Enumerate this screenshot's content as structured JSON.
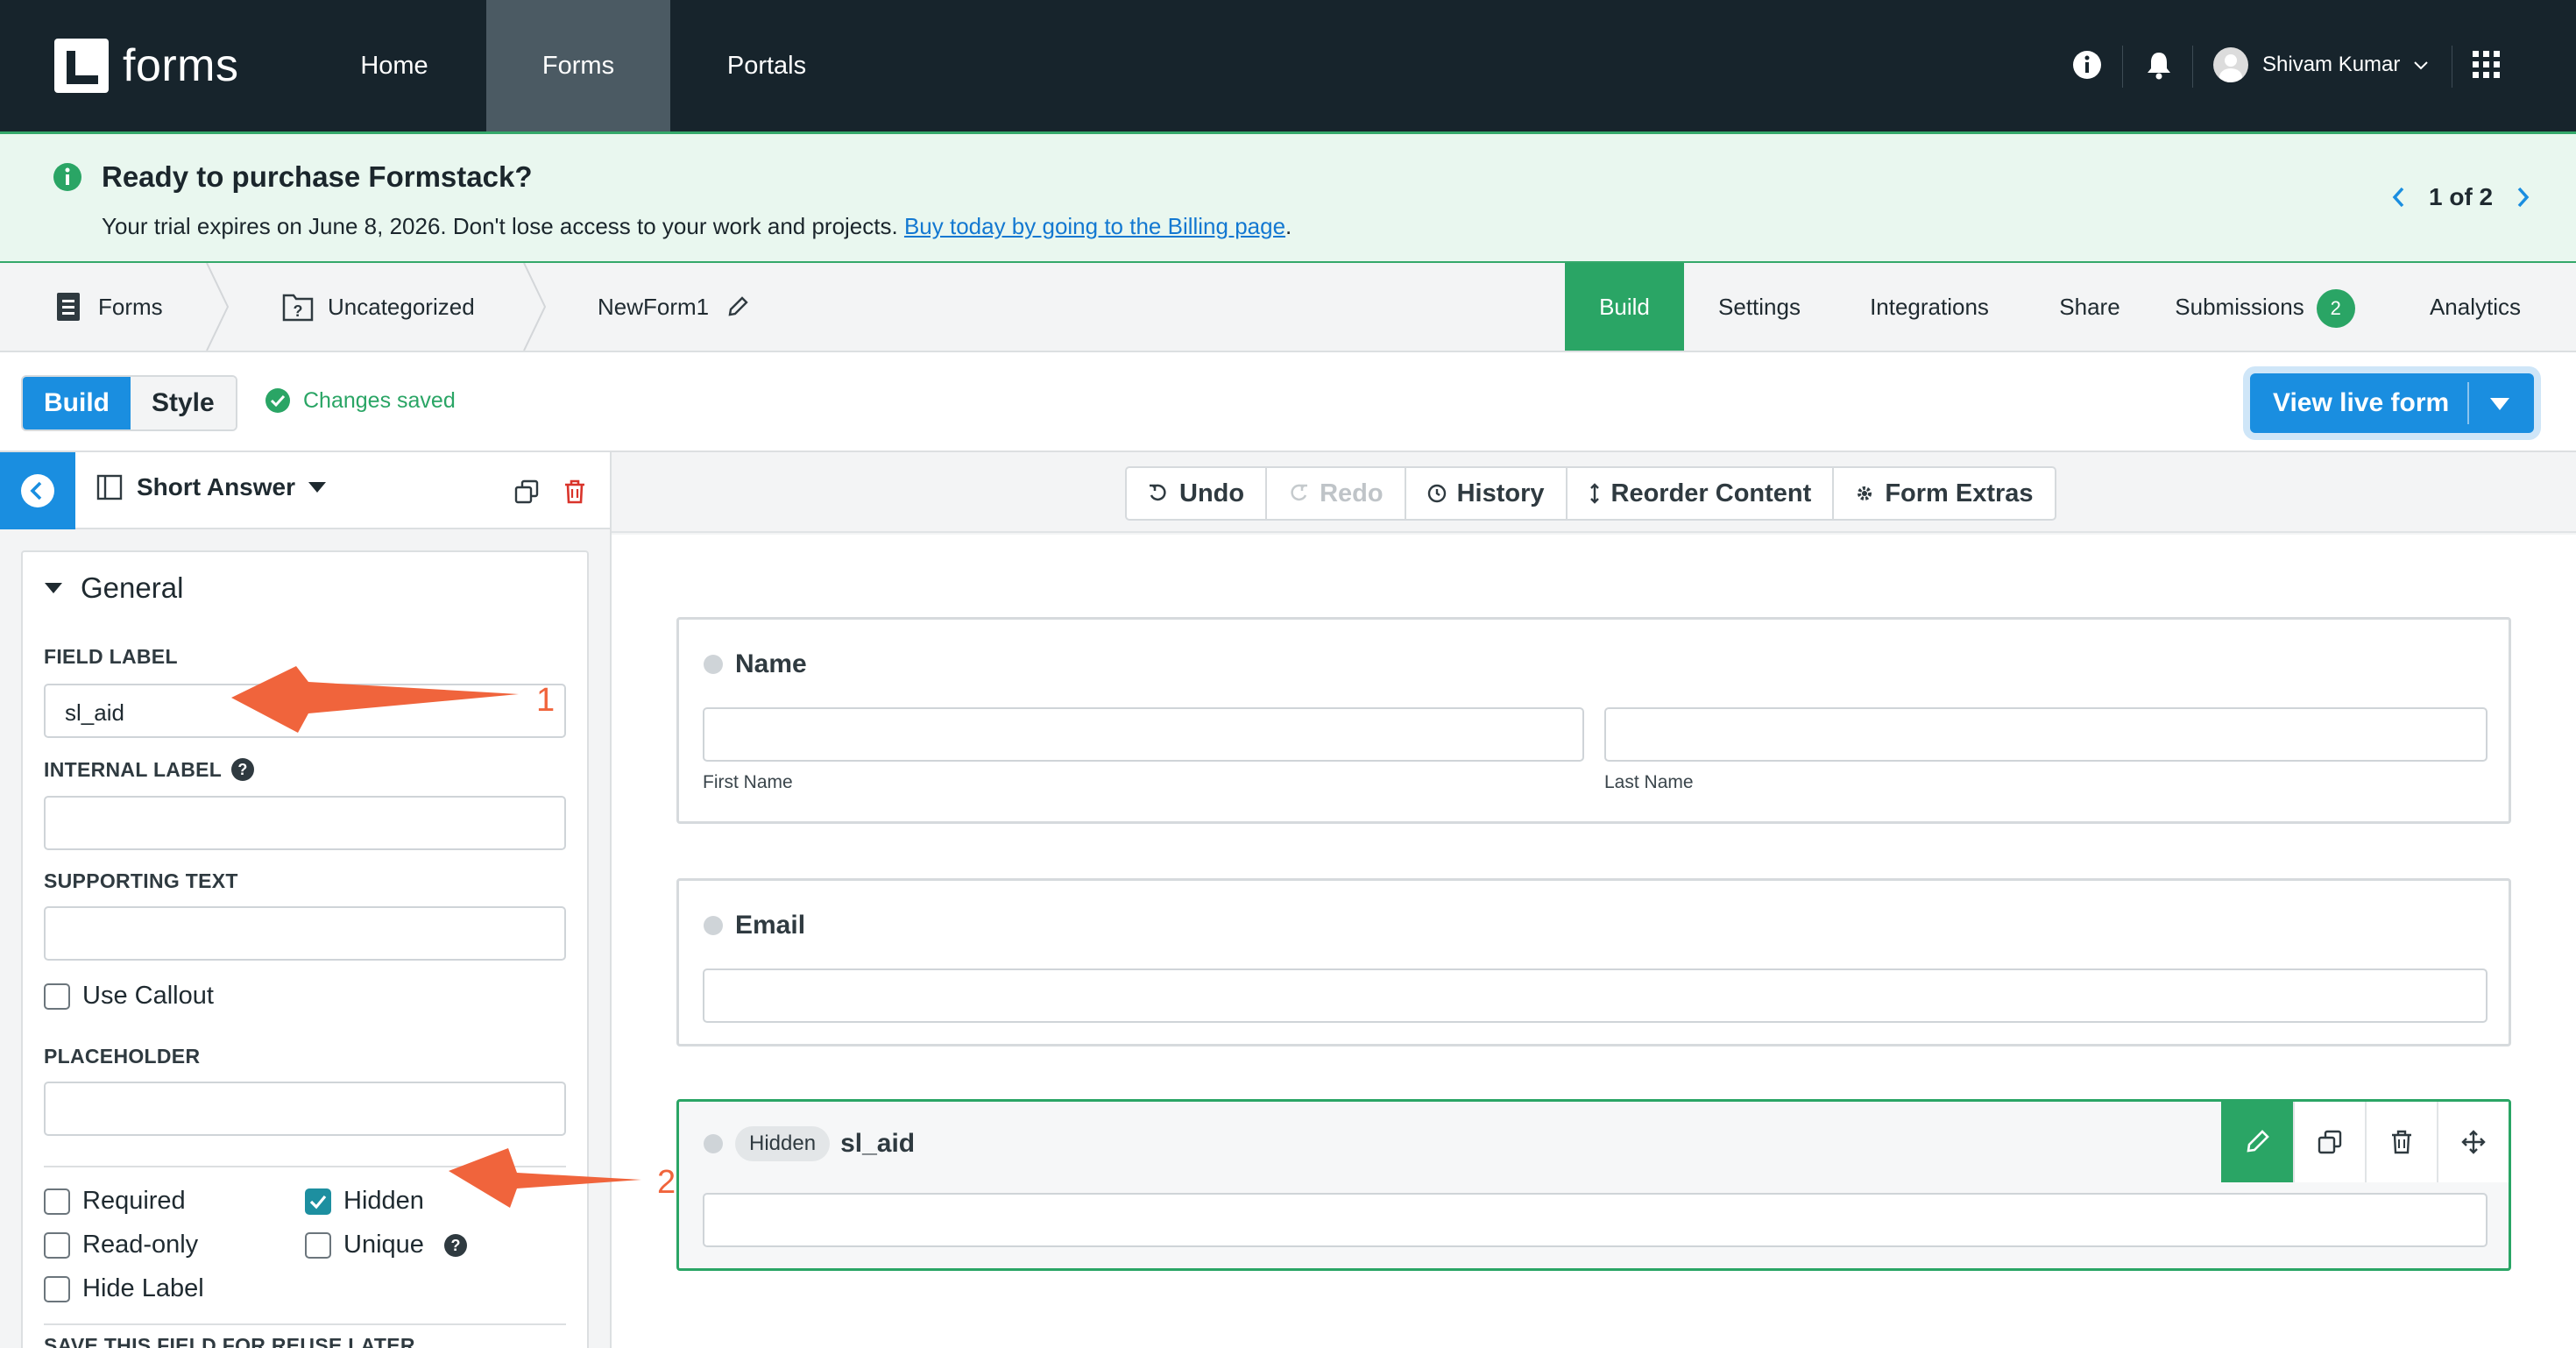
{
  "nav": {
    "logo_text": "forms",
    "items": [
      "Home",
      "Forms",
      "Portals"
    ],
    "user_name": "Shivam Kumar"
  },
  "banner": {
    "title": "Ready to purchase Formstack?",
    "text": "Your trial expires on June 8, 2026. Don't lose access to your work and projects.",
    "link": "Buy today by going to the Billing page",
    "suffix": ".",
    "pager": "1 of 2"
  },
  "breadcrumb": [
    "Forms",
    "Uncategorized",
    "NewForm1"
  ],
  "tabs": {
    "build": "Build",
    "settings": "Settings",
    "integrations": "Integrations",
    "share": "Share",
    "submissions": "Submissions",
    "submissions_count": "2",
    "analytics": "Analytics"
  },
  "builder": {
    "mode_build": "Build",
    "mode_style": "Style",
    "status": "Changes saved",
    "view_live": "View live form"
  },
  "left_panel": {
    "field_type": "Short Answer",
    "section": "General",
    "field_label_cap": "FIELD LABEL",
    "field_label_value": "sl_aid",
    "internal_label_cap": "INTERNAL LABEL",
    "supporting_text_cap": "SUPPORTING TEXT",
    "use_callout": "Use Callout",
    "placeholder_cap": "PLACEHOLDER",
    "required": "Required",
    "hidden": "Hidden",
    "read_only": "Read-only",
    "unique": "Unique",
    "hide_label": "Hide Label",
    "save_cap": "SAVE THIS FIELD FOR REUSE LATER",
    "checks": {
      "use_callout": false,
      "required": false,
      "hidden": true,
      "read_only": false,
      "unique": false,
      "hide_label": false
    }
  },
  "toolbar": {
    "undo": "Undo",
    "redo": "Redo",
    "history": "History",
    "reorder": "Reorder Content",
    "extras": "Form Extras"
  },
  "form": {
    "name_label": "Name",
    "first_name": "First Name",
    "last_name": "Last Name",
    "email_label": "Email",
    "hidden_pill": "Hidden",
    "hidden_field_label": "sl_aid"
  },
  "annotations": [
    "1",
    "2"
  ],
  "colors": {
    "nav_bg": "#17242c",
    "accent_green": "#2aa565",
    "accent_blue": "#1a8ee0",
    "annotation": "#f0643c"
  }
}
